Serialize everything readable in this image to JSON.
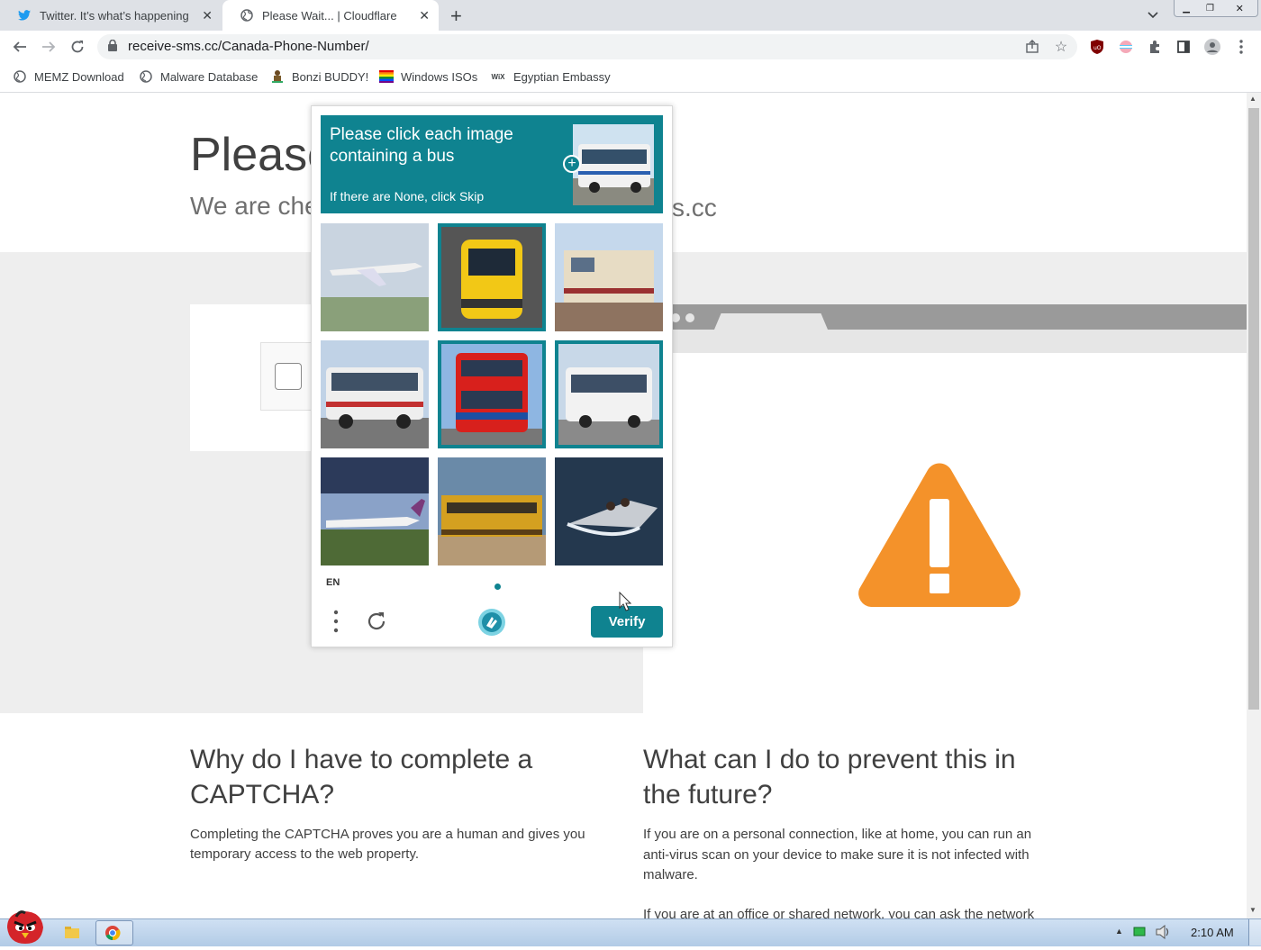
{
  "tabs": [
    {
      "label": "Twitter. It’s what’s happening",
      "close": "✕",
      "icon": "twitter-icon"
    },
    {
      "label": "Please Wait... | Cloudflare",
      "close": "✕",
      "icon": "globe-icon"
    }
  ],
  "new_tab": "+",
  "address": {
    "url": "receive-sms.cc/Canada-Phone-Number/"
  },
  "bookmarks": [
    {
      "label": "MEMZ Download",
      "icon": "globe-icon"
    },
    {
      "label": "Malware Database",
      "icon": "globe-icon"
    },
    {
      "label": "Bonzi BUDDY!",
      "icon": "bonzi-icon"
    },
    {
      "label": "Windows ISOs",
      "icon": "windows-icon"
    },
    {
      "label": "Egyptian Embassy",
      "icon": "wix-icon"
    }
  ],
  "page": {
    "title_partial": "Please",
    "subtitle_left": "We are che",
    "subtitle_right": "s.cc",
    "why_heading": "Why do I have to complete a CAPTCHA?",
    "why_text": "Completing the CAPTCHA proves you are a human and gives you temporary access to the web property.",
    "prevent_heading": "What can I do to prevent this in the future?",
    "prevent_text": "If you are on a personal connection, like at home, you can run an anti-virus scan on your device to make sure it is not infected with malware.",
    "prevent_text2": "If you are at an office or shared network, you can ask the network"
  },
  "captcha": {
    "prompt": "Please click each image containing a bus",
    "hint": "If there are None, click Skip",
    "lang": "EN",
    "verify_label": "Verify",
    "tiles": [
      {
        "subject": "airplane",
        "selected": false
      },
      {
        "subject": "yellow train",
        "selected": true
      },
      {
        "subject": "locomotive",
        "selected": false
      },
      {
        "subject": "bus",
        "selected": false
      },
      {
        "subject": "red double-decker bus",
        "selected": true
      },
      {
        "subject": "bus",
        "selected": true
      },
      {
        "subject": "airplane",
        "selected": false
      },
      {
        "subject": "train",
        "selected": false
      },
      {
        "subject": "speedboat",
        "selected": false
      }
    ]
  },
  "taskbar": {
    "time": "2:10 AM"
  },
  "colors": {
    "captcha_accent": "#0f8390",
    "warning": "#f4922a"
  }
}
